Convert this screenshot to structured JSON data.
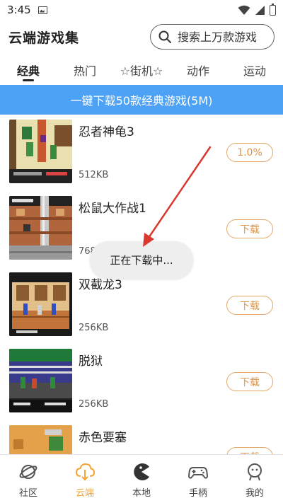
{
  "status_bar": {
    "time": "3:45"
  },
  "header": {
    "title": "云端游戏集"
  },
  "search": {
    "placeholder": "搜索上万款游戏"
  },
  "tabs": [
    {
      "label": "经典",
      "active": true
    },
    {
      "label": "热门",
      "active": false
    },
    {
      "label": "☆街机☆",
      "active": false
    },
    {
      "label": "动作",
      "active": false
    },
    {
      "label": "运动",
      "active": false
    }
  ],
  "banner": {
    "text": "一键下载50款经典游戏(5M)"
  },
  "games": [
    {
      "name": "忍者神龟3",
      "size": "512KB",
      "button": "1.0%",
      "progress_percent": 1.0
    },
    {
      "name": "松鼠大作战1",
      "size": "768KB",
      "button": "下载"
    },
    {
      "name": "双截龙3",
      "size": "256KB",
      "button": "下载"
    },
    {
      "name": "脱狱",
      "size": "256KB",
      "button": "下载"
    },
    {
      "name": "赤色要塞",
      "size": "",
      "button": "下载"
    }
  ],
  "toast": {
    "text": "正在下载中..."
  },
  "bottom_nav": [
    {
      "label": "社区",
      "icon": "planet-icon",
      "active": false
    },
    {
      "label": "云端",
      "icon": "cloud-download-icon",
      "active": true
    },
    {
      "label": "本地",
      "icon": "pacman-icon",
      "active": false
    },
    {
      "label": "手柄",
      "icon": "gamepad-icon",
      "active": false
    },
    {
      "label": "我的",
      "icon": "user-face-icon",
      "active": false
    }
  ],
  "colors": {
    "accent": "#f2a532",
    "banner": "#4ea2f5",
    "button_border": "#e2a969"
  }
}
